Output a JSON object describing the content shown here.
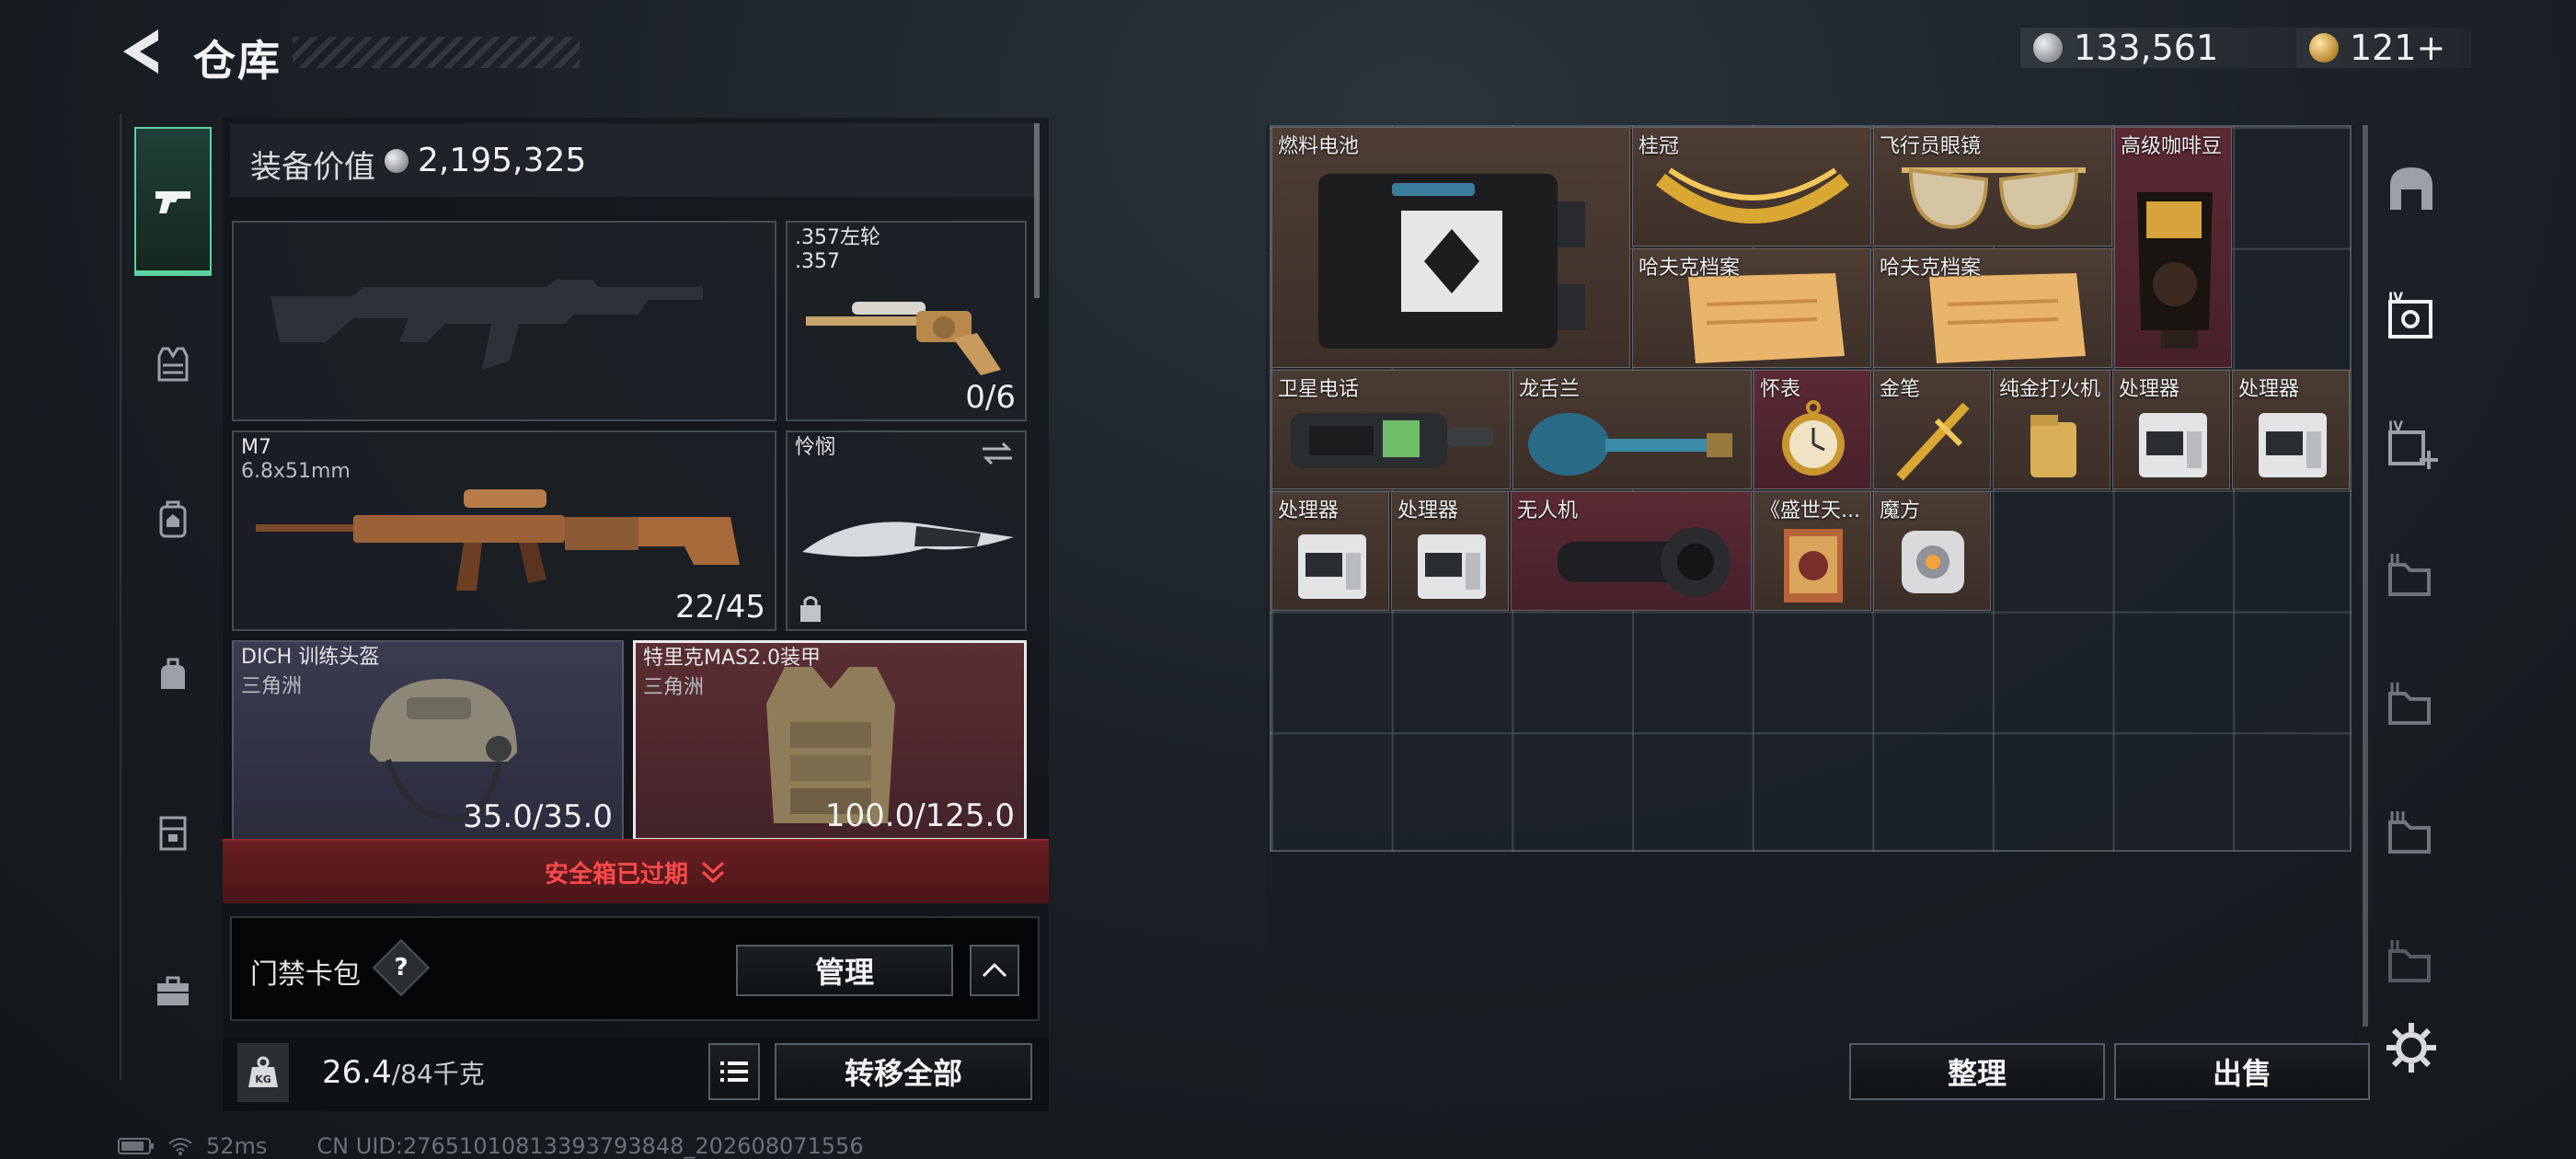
{
  "header": {
    "title": "仓库",
    "currency_silver": "133,561",
    "currency_gold": "121+"
  },
  "nav": {
    "items": [
      "weapons-icon",
      "armor-vest-icon",
      "backpack-icon",
      "pouch-icon",
      "container-icon",
      "briefcase-icon"
    ],
    "active_index": 0
  },
  "equipment": {
    "value_label": "装备价值",
    "value": "2,195,325",
    "slots": {
      "revolver": {
        "name": ".357左轮",
        "ammo": ".357",
        "count": "0/6"
      },
      "rifle": {
        "name": "M7",
        "ammo": "6.8x51mm",
        "count": "22/45"
      },
      "knife": {
        "name": "怜悯"
      },
      "helmet": {
        "name": "DICH 训练头盔",
        "sub": "三角洲",
        "durability": "35.0/35.0"
      },
      "armor": {
        "name": "特里克MAS2.0装甲",
        "sub": "三角洲",
        "durability": "100.0/125.0"
      }
    },
    "safe_box_status": "安全箱已过期",
    "card_pack_label": "门禁卡包",
    "help_label": "?",
    "manage_button": "管理",
    "weight_value": "26.4",
    "weight_max": "/84千克",
    "transfer_all_button": "转移全部"
  },
  "status_bar": {
    "ping": "52ms",
    "uid": "CN UID:27651010813393793848_202608071556"
  },
  "stash": {
    "items": [
      {
        "name": "燃料电池",
        "color": "brown"
      },
      {
        "name": "桂冠",
        "color": "brown"
      },
      {
        "name": "飞行员眼镜",
        "color": "brown"
      },
      {
        "name": "高级咖啡豆",
        "color": "red"
      },
      {
        "name": "哈夫克档案",
        "color": "brown"
      },
      {
        "name": "哈夫克档案",
        "color": "brown"
      },
      {
        "name": "卫星电话",
        "color": "brown"
      },
      {
        "name": "龙舌兰",
        "color": "brown"
      },
      {
        "name": "怀表",
        "color": "red"
      },
      {
        "name": "金笔",
        "color": "brown"
      },
      {
        "name": "纯金打火机",
        "color": "brown"
      },
      {
        "name": "处理器",
        "color": "brown"
      },
      {
        "name": "处理器",
        "color": "brown"
      },
      {
        "name": "处理器",
        "color": "brown"
      },
      {
        "name": "处理器",
        "color": "brown"
      },
      {
        "name": "无人机",
        "color": "red"
      },
      {
        "name": "《盛世天...",
        "color": "brown"
      },
      {
        "name": "魔方",
        "color": "brown"
      }
    ],
    "sort_button": "整理",
    "sell_button": "出售"
  },
  "right_nav": {
    "items": [
      "home-base-icon",
      "safe-box-iv-icon",
      "safe-box-add-icon",
      "storage-1-icon",
      "storage-2-icon",
      "storage-3-icon",
      "storage-4-icon",
      "settings-gear-icon"
    ]
  },
  "colors": {
    "accent_green": "#5bd3a0",
    "alert_red": "#ff4a4a",
    "item_brown": "#4d3d33",
    "item_red": "#5a2a33"
  }
}
